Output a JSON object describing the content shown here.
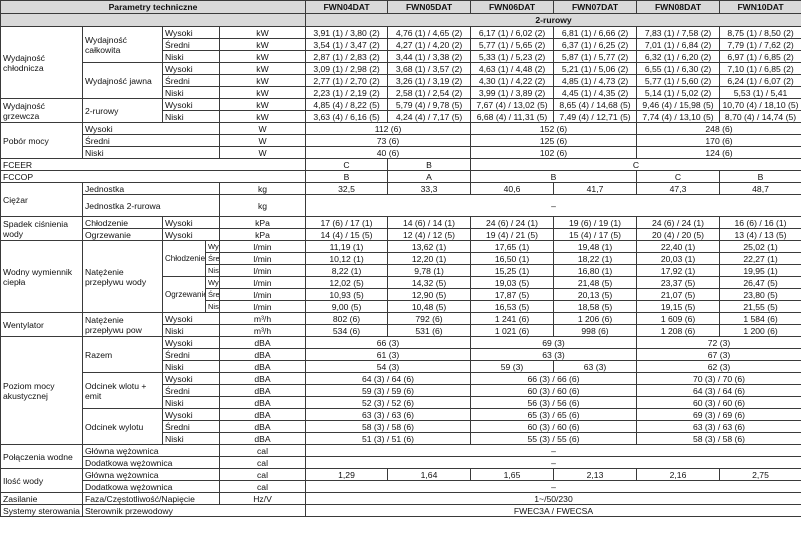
{
  "header": {
    "param": "Parametry techniczne",
    "models": [
      "FWN04DAT",
      "FWN05DAT",
      "FWN06DAT",
      "FWN07DAT",
      "FWN08DAT",
      "FWN10DAT"
    ],
    "subheader": "2-rurowy"
  },
  "labels": {
    "wyd_chlod": "Wydajność chłodnicza",
    "wyd_calk": "Wydajność całkowita",
    "wyd_jawna": "Wydajność jawna",
    "wyd_grz": "Wydajność grzewcza",
    "two_pipe": "2-rurowy",
    "pobor": "Pobór mocy",
    "fceer": "FCEER",
    "fccop": "FCCOP",
    "ciezar": "Ciężar",
    "jednostka": "Jednostka",
    "jednostka2": "Jednostka 2-rurowa",
    "spadek": "Spadek ciśnienia wody",
    "chlodzenie_c": "Chłodzenie",
    "ogrzewanie_c": "Ogrzewanie",
    "wymiennik": "Wodny wymiennik ciepła",
    "natezenie": "Natężenie przepływu wody",
    "chlodzenie": "Chłodzenie",
    "ogrzewanie": "Ogrzewanie",
    "wentylator": "Wentylator",
    "natezenie_pow": "Natężenie przepływu pow",
    "poziom": "Poziom mocy akustycznej",
    "razem": "Razem",
    "wlot": "Odcinek wlotu + emit",
    "wylot": "Odcinek wylotu",
    "polaczenia": "Połączenia wodne",
    "ilosc": "Ilość wody",
    "glowna": "Główna wężownica",
    "dodatkowa": "Dodatkowa wężownica",
    "zasilanie": "Zasilanie",
    "faza": "Faza/Częstotliwość/Napięcie",
    "systemy": "Systemy sterowania",
    "sterownik": "Sterownik przewodowy",
    "wysoki": "Wysoki",
    "sredni": "Średni",
    "niski": "Niski"
  },
  "units": {
    "kw": "kW",
    "w": "W",
    "kg": "kg",
    "kpa": "kPa",
    "lmin": "l/min",
    "m3h": "m³/h",
    "dba": "dBA",
    "cal": "cal",
    "hzv": "Hz/V"
  },
  "rows": {
    "calk_w": [
      "3,91 (1) / 3,80 (2)",
      "4,76 (1) / 4,65 (2)",
      "6,17 (1) / 6,02 (2)",
      "6,81 (1) / 6,66 (2)",
      "7,83 (1) / 7,58 (2)",
      "8,75 (1) / 8,50 (2)"
    ],
    "calk_s": [
      "3,54 (1) / 3,47 (2)",
      "4,27 (1) / 4,20 (2)",
      "5,77 (1) / 5,65 (2)",
      "6,37 (1) / 6,25 (2)",
      "7,01 (1) / 6,84 (2)",
      "7,79 (1) / 7,62 (2)"
    ],
    "calk_n": [
      "2,87 (1) / 2,83 (2)",
      "3,44 (1) / 3,38 (2)",
      "5,33 (1) / 5,23 (2)",
      "5,87 (1) / 5,77 (2)",
      "6,32 (1) / 6,20 (2)",
      "6,97 (1) / 6,85 (2)"
    ],
    "jaw_w": [
      "3,09 (1) / 2,98 (2)",
      "3,68 (1) / 3,57 (2)",
      "4,63 (1) / 4,48 (2)",
      "5,21 (1) / 5,06 (2)",
      "6,55 (1) / 6,30 (2)",
      "7,10 (1) / 6,85 (2)"
    ],
    "jaw_s": [
      "2,77 (1) / 2,70 (2)",
      "3,26 (1) / 3,19 (2)",
      "4,30 (1) / 4,22 (2)",
      "4,85 (1) / 4,73 (2)",
      "5,77 (1) / 5,60 (2)",
      "6,24 (1) / 6,07 (2)"
    ],
    "jaw_n": [
      "2,23 (1) / 2,19 (2)",
      "2,58 (1) / 2,54 (2)",
      "3,99 (1) / 3,89 (2)",
      "4,45 (1) / 4,35 (2)",
      "5,14 (1) / 5,02 (2)",
      "5,53 (1) / 5,41"
    ],
    "grz_w": [
      "4,85 (4) / 8,22 (5)",
      "5,79 (4) / 9,78 (5)",
      "7,67 (4) / 13,02 (5)",
      "8,65 (4) / 14,68 (5)",
      "9,46 (4) / 15,98 (5)",
      "10,70 (4) / 18,10 (5)"
    ],
    "grz_n": [
      "3,63 (4) / 6,16 (5)",
      "4,24 (4) / 7,17 (5)",
      "6,68 (4) / 11,31 (5)",
      "7,49 (4) / 12,71 (5)",
      "7,74 (4) / 13,10 (5)",
      "8,70 (4) / 14,74 (5)"
    ],
    "pob_w": [
      "112 (6)",
      "152 (6)",
      "248 (6)"
    ],
    "pob_s": [
      "73 (6)",
      "125 (6)",
      "170 (6)"
    ],
    "pob_n": [
      "40 (6)",
      "102 (6)",
      "124 (6)"
    ],
    "fceer": [
      "C",
      "B",
      "C"
    ],
    "fccop": [
      "B",
      "A",
      "B",
      "C",
      "B"
    ],
    "ciezar": [
      "32,5",
      "33,3",
      "40,6",
      "41,7",
      "47,3",
      "48,7"
    ],
    "ciezar2": "–",
    "spad_ch": [
      "17 (6) / 17 (1)",
      "14 (6) / 14 (1)",
      "24 (6) / 24 (1)",
      "19 (6) / 19 (1)",
      "24 (6) / 24 (1)",
      "16 (6) / 16 (1)"
    ],
    "spad_og": [
      "14 (4) / 15 (5)",
      "12 (4) / 12 (5)",
      "19 (4) / 21 (5)",
      "15 (4) / 17 (5)",
      "20 (4) / 20 (5)",
      "13 (4) / 13 (5)"
    ],
    "nat_ch_w": [
      "11,19 (1)",
      "13,62 (1)",
      "17,65 (1)",
      "19,48 (1)",
      "22,40 (1)",
      "25,02 (1)"
    ],
    "nat_ch_s": [
      "10,12 (1)",
      "12,20 (1)",
      "16,50 (1)",
      "18,22 (1)",
      "20,03 (1)",
      "22,27 (1)"
    ],
    "nat_ch_n": [
      "8,22 (1)",
      "9,78 (1)",
      "15,25 (1)",
      "16,80 (1)",
      "17,92 (1)",
      "19,95 (1)"
    ],
    "nat_og_w": [
      "12,02 (5)",
      "14,32 (5)",
      "19,03 (5)",
      "21,48 (5)",
      "23,37 (5)",
      "26,47 (5)"
    ],
    "nat_og_s": [
      "10,93 (5)",
      "12,90 (5)",
      "17,87 (5)",
      "20,13 (5)",
      "21,07 (5)",
      "23,80 (5)"
    ],
    "nat_og_n": [
      "9,00 (5)",
      "10,48 (5)",
      "16,53 (5)",
      "18,58 (5)",
      "19,15 (5)",
      "21,55 (5)"
    ],
    "went_w": [
      "802 (6)",
      "792 (6)",
      "1 241 (6)",
      "1 206 (6)",
      "1 609 (6)",
      "1 584 (6)"
    ],
    "went_n": [
      "534 (6)",
      "531 (6)",
      "1 021 (6)",
      "998 (6)",
      "1 208 (6)",
      "1 200 (6)"
    ],
    "raz_w": [
      "66 (3)",
      "69 (3)",
      "72 (3)"
    ],
    "raz_s": [
      "61 (3)",
      "63 (3)",
      "67 (3)"
    ],
    "raz_n": [
      "54 (3)",
      "59 (3)",
      "63 (3)",
      "62 (3)"
    ],
    "wl_w": [
      "64 (3) / 64 (6)",
      "66 (3) / 66 (6)",
      "70 (3) / 70 (6)"
    ],
    "wl_s": [
      "59 (3) / 59 (6)",
      "60 (3) / 60 (6)",
      "64 (3) / 64 (6)"
    ],
    "wl_n": [
      "52 (3) / 52 (6)",
      "56 (3) / 56 (6)",
      "60 (3) / 60 (6)"
    ],
    "wy_w": [
      "63 (3) / 63 (6)",
      "65 (3) / 65 (6)",
      "69 (3) / 69 (6)"
    ],
    "wy_s": [
      "58 (3) / 58 (6)",
      "60 (3) / 60 (6)",
      "63 (3) / 63 (6)"
    ],
    "wy_n": [
      "51 (3) / 51 (6)",
      "55 (3) / 55 (6)",
      "58 (3) / 58 (6)"
    ],
    "pol_gl": "–",
    "pol_dod": "–",
    "il_gl": [
      "1,29",
      "1,64",
      "1,65",
      "2,13",
      "2,16",
      "2,75"
    ],
    "il_dod": "–",
    "zas": "1~/50/230",
    "ster": "FWEC3A / FWECSA"
  }
}
